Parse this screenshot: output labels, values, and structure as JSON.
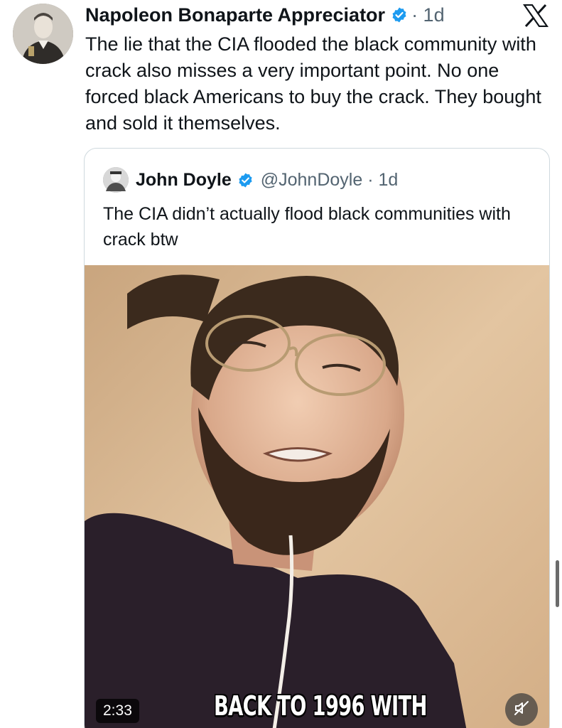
{
  "tweet": {
    "author_name": "Napoleon Bonaparte Appreciator",
    "time": "· 1d",
    "text": "The lie that the CIA flooded the black community with crack also misses a very important point. No one forced black Americans to buy the crack. They bought and sold it themselves."
  },
  "quoted": {
    "author_name": "John Doyle",
    "handle_time": "@JohnDoyle · 1d",
    "text": "The CIA didn’t actually flood black communities with crack btw",
    "video": {
      "duration": "2:33",
      "caption": "BACK TO 1996 WITH"
    }
  },
  "icons": {
    "verified": "verified-badge-icon",
    "logo": "x-logo-icon",
    "mute": "muted-speaker-icon"
  },
  "colors": {
    "verified_blue": "#1d9bf0",
    "text_primary": "#0f1419",
    "text_secondary": "#536471"
  }
}
